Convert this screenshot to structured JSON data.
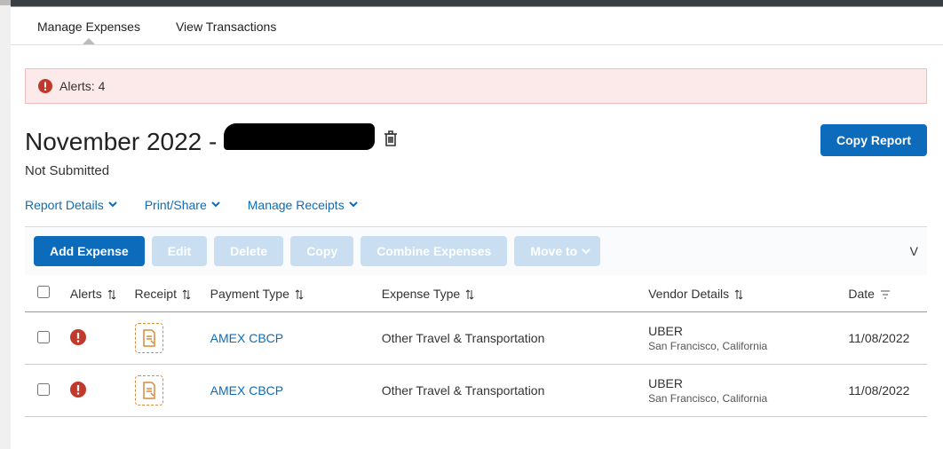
{
  "tabs": {
    "manage": "Manage Expenses",
    "viewtx": "View Transactions"
  },
  "alert_banner": "Alerts: 4",
  "report": {
    "title_prefix": "November 2022 - ",
    "status": "Not Submitted",
    "copy_label": "Copy Report"
  },
  "link_toolbar": {
    "details": "Report Details",
    "print": "Print/Share",
    "receipts": "Manage Receipts"
  },
  "action_bar": {
    "add": "Add Expense",
    "edit": "Edit",
    "delete": "Delete",
    "copy": "Copy",
    "combine": "Combine Expenses",
    "move": "Move to",
    "view_initial": "V"
  },
  "columns": {
    "alerts": "Alerts",
    "receipt": "Receipt",
    "paytype": "Payment Type",
    "exptype": "Expense Type",
    "vendor": "Vendor Details",
    "date": "Date"
  },
  "rows": [
    {
      "paytype": "AMEX CBCP",
      "exptype": "Other Travel & Transportation",
      "vendor": "UBER",
      "vendor_loc": "San Francisco, California",
      "date": "11/08/2022"
    },
    {
      "paytype": "AMEX CBCP",
      "exptype": "Other Travel & Transportation",
      "vendor": "UBER",
      "vendor_loc": "San Francisco, California",
      "date": "11/08/2022"
    }
  ]
}
